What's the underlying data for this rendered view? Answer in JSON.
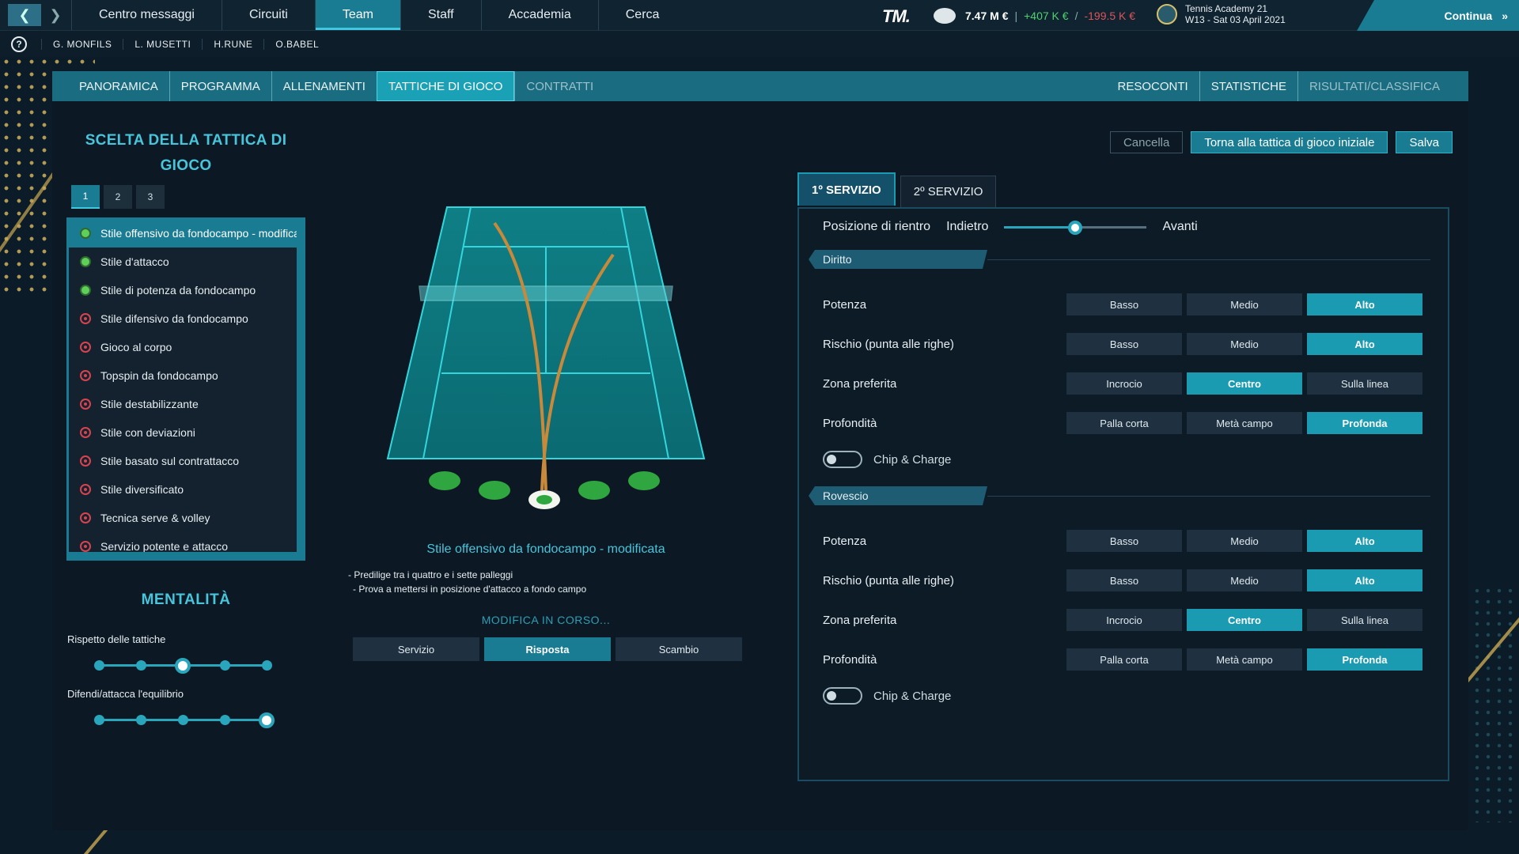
{
  "topbar": {
    "nav_items": [
      "Centro messaggi",
      "Circuiti",
      "Team",
      "Staff",
      "Accademia",
      "Cerca"
    ],
    "active_nav": "Team",
    "logo_text": "TM.",
    "money_total": "7.47 M €",
    "money_gain": "+407 K €",
    "money_loss": "-199.5 K €",
    "money_sep": "/",
    "academy_name": "Tennis Academy 21",
    "academy_date": "W13 - Sat 03 April 2021",
    "continue_label": "Continua"
  },
  "players": [
    "G. MONFILS",
    "L. MUSETTI",
    "H.RUNE",
    "O.BABEL"
  ],
  "subtabs": {
    "left": [
      "PANORAMICA",
      "PROGRAMMA",
      "ALLENAMENTI",
      "TATTICHE DI GIOCO",
      "CONTRATTI"
    ],
    "right": [
      "RESOCONTI",
      "STATISTICHE",
      "RISULTATI/CLASSIFICA"
    ]
  },
  "left": {
    "title": "SCELTA DELLA TATTICA DI GIOCO",
    "num_tabs": [
      "1",
      "2",
      "3"
    ],
    "tactics": [
      {
        "label": "Stile offensivo da fondocampo - modificata",
        "status": "green"
      },
      {
        "label": "Stile d'attacco",
        "status": "green"
      },
      {
        "label": "Stile di potenza da fondocampo",
        "status": "green"
      },
      {
        "label": "Stile difensivo da fondocampo",
        "status": "red"
      },
      {
        "label": "Gioco al corpo",
        "status": "red"
      },
      {
        "label": "Topspin da fondocampo",
        "status": "red"
      },
      {
        "label": "Stile destabilizzante",
        "status": "red"
      },
      {
        "label": "Stile con deviazioni",
        "status": "red"
      },
      {
        "label": "Stile basato sul contrattacco",
        "status": "red"
      },
      {
        "label": "Stile diversificato",
        "status": "red"
      },
      {
        "label": "Tecnica serve & volley",
        "status": "red"
      },
      {
        "label": "Servizio potente e attacco",
        "status": "red"
      }
    ],
    "mentality_title": "MENTALITÀ",
    "mentality": [
      {
        "label": "Rispetto delle tattiche",
        "steps": 5,
        "value": 3
      },
      {
        "label": "Difendi/attacca l'equilibrio",
        "steps": 5,
        "value": 5
      }
    ]
  },
  "center": {
    "tactic_name": "Stile offensivo da fondocampo - modificata",
    "desc": [
      "- Predilige tra i quattro e i sette palleggi",
      "- Prova a mettersi in posizione d'attacco a fondo campo"
    ],
    "modifica": "MODIFICA IN CORSO...",
    "phases": [
      "Servizio",
      "Risposta",
      "Scambio"
    ],
    "active_phase": "Risposta"
  },
  "right": {
    "actions": {
      "cancel": "Cancella",
      "reset": "Torna alla tattica di gioco iniziale",
      "save": "Salva"
    },
    "serve_tabs": [
      "1º SERVIZIO",
      "2º SERVIZIO"
    ],
    "position_label": "Posizione di rientro",
    "position_left": "Indietro",
    "position_right": "Avanti",
    "position_value": 0.5,
    "sections": [
      {
        "title": "Diritto",
        "rows": [
          {
            "label": "Potenza",
            "options": [
              "Basso",
              "Medio",
              "Alto"
            ],
            "selected": 2
          },
          {
            "label": "Rischio (punta alle righe)",
            "options": [
              "Basso",
              "Medio",
              "Alto"
            ],
            "selected": 2
          },
          {
            "label": "Zona preferita",
            "options": [
              "Incrocio",
              "Centro",
              "Sulla linea"
            ],
            "selected": 1
          },
          {
            "label": "Profondità",
            "options": [
              "Palla corta",
              "Metà campo",
              "Profonda"
            ],
            "selected": 2
          }
        ],
        "chip_label": "Chip & Charge",
        "chip_on": false
      },
      {
        "title": "Rovescio",
        "rows": [
          {
            "label": "Potenza",
            "options": [
              "Basso",
              "Medio",
              "Alto"
            ],
            "selected": 2
          },
          {
            "label": "Rischio (punta alle righe)",
            "options": [
              "Basso",
              "Medio",
              "Alto"
            ],
            "selected": 2
          },
          {
            "label": "Zona preferita",
            "options": [
              "Incrocio",
              "Centro",
              "Sulla linea"
            ],
            "selected": 1
          },
          {
            "label": "Profondità",
            "options": [
              "Palla corta",
              "Metà campo",
              "Profonda"
            ],
            "selected": 2
          }
        ],
        "chip_label": "Chip & Charge",
        "chip_on": false
      }
    ]
  },
  "colors": {
    "accent": "#1a7c93",
    "highlight": "#48c4db",
    "gain": "#4fd26e",
    "loss": "#e0535a",
    "court": "#0f8a8f"
  }
}
